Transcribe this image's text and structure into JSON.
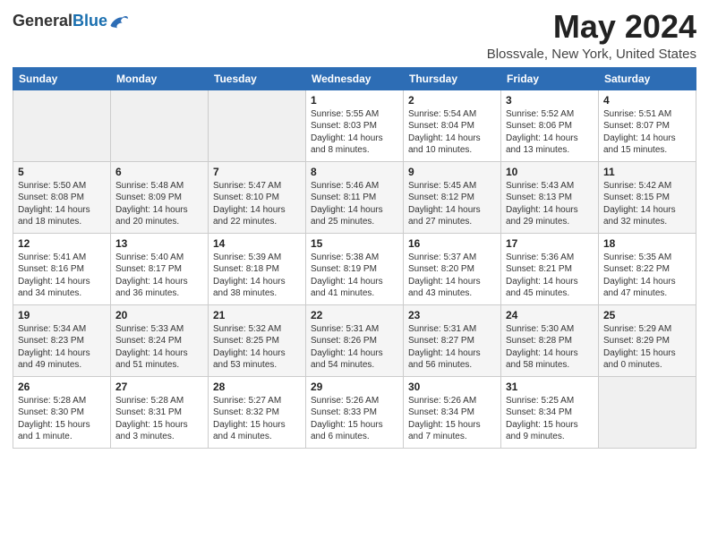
{
  "header": {
    "logo_general": "General",
    "logo_blue": "Blue",
    "title": "May 2024",
    "subtitle": "Blossvale, New York, United States"
  },
  "days_of_week": [
    "Sunday",
    "Monday",
    "Tuesday",
    "Wednesday",
    "Thursday",
    "Friday",
    "Saturday"
  ],
  "weeks": [
    [
      {
        "day": "",
        "info": ""
      },
      {
        "day": "",
        "info": ""
      },
      {
        "day": "",
        "info": ""
      },
      {
        "day": "1",
        "info": "Sunrise: 5:55 AM\nSunset: 8:03 PM\nDaylight: 14 hours\nand 8 minutes."
      },
      {
        "day": "2",
        "info": "Sunrise: 5:54 AM\nSunset: 8:04 PM\nDaylight: 14 hours\nand 10 minutes."
      },
      {
        "day": "3",
        "info": "Sunrise: 5:52 AM\nSunset: 8:06 PM\nDaylight: 14 hours\nand 13 minutes."
      },
      {
        "day": "4",
        "info": "Sunrise: 5:51 AM\nSunset: 8:07 PM\nDaylight: 14 hours\nand 15 minutes."
      }
    ],
    [
      {
        "day": "5",
        "info": "Sunrise: 5:50 AM\nSunset: 8:08 PM\nDaylight: 14 hours\nand 18 minutes."
      },
      {
        "day": "6",
        "info": "Sunrise: 5:48 AM\nSunset: 8:09 PM\nDaylight: 14 hours\nand 20 minutes."
      },
      {
        "day": "7",
        "info": "Sunrise: 5:47 AM\nSunset: 8:10 PM\nDaylight: 14 hours\nand 22 minutes."
      },
      {
        "day": "8",
        "info": "Sunrise: 5:46 AM\nSunset: 8:11 PM\nDaylight: 14 hours\nand 25 minutes."
      },
      {
        "day": "9",
        "info": "Sunrise: 5:45 AM\nSunset: 8:12 PM\nDaylight: 14 hours\nand 27 minutes."
      },
      {
        "day": "10",
        "info": "Sunrise: 5:43 AM\nSunset: 8:13 PM\nDaylight: 14 hours\nand 29 minutes."
      },
      {
        "day": "11",
        "info": "Sunrise: 5:42 AM\nSunset: 8:15 PM\nDaylight: 14 hours\nand 32 minutes."
      }
    ],
    [
      {
        "day": "12",
        "info": "Sunrise: 5:41 AM\nSunset: 8:16 PM\nDaylight: 14 hours\nand 34 minutes."
      },
      {
        "day": "13",
        "info": "Sunrise: 5:40 AM\nSunset: 8:17 PM\nDaylight: 14 hours\nand 36 minutes."
      },
      {
        "day": "14",
        "info": "Sunrise: 5:39 AM\nSunset: 8:18 PM\nDaylight: 14 hours\nand 38 minutes."
      },
      {
        "day": "15",
        "info": "Sunrise: 5:38 AM\nSunset: 8:19 PM\nDaylight: 14 hours\nand 41 minutes."
      },
      {
        "day": "16",
        "info": "Sunrise: 5:37 AM\nSunset: 8:20 PM\nDaylight: 14 hours\nand 43 minutes."
      },
      {
        "day": "17",
        "info": "Sunrise: 5:36 AM\nSunset: 8:21 PM\nDaylight: 14 hours\nand 45 minutes."
      },
      {
        "day": "18",
        "info": "Sunrise: 5:35 AM\nSunset: 8:22 PM\nDaylight: 14 hours\nand 47 minutes."
      }
    ],
    [
      {
        "day": "19",
        "info": "Sunrise: 5:34 AM\nSunset: 8:23 PM\nDaylight: 14 hours\nand 49 minutes."
      },
      {
        "day": "20",
        "info": "Sunrise: 5:33 AM\nSunset: 8:24 PM\nDaylight: 14 hours\nand 51 minutes."
      },
      {
        "day": "21",
        "info": "Sunrise: 5:32 AM\nSunset: 8:25 PM\nDaylight: 14 hours\nand 53 minutes."
      },
      {
        "day": "22",
        "info": "Sunrise: 5:31 AM\nSunset: 8:26 PM\nDaylight: 14 hours\nand 54 minutes."
      },
      {
        "day": "23",
        "info": "Sunrise: 5:31 AM\nSunset: 8:27 PM\nDaylight: 14 hours\nand 56 minutes."
      },
      {
        "day": "24",
        "info": "Sunrise: 5:30 AM\nSunset: 8:28 PM\nDaylight: 14 hours\nand 58 minutes."
      },
      {
        "day": "25",
        "info": "Sunrise: 5:29 AM\nSunset: 8:29 PM\nDaylight: 15 hours\nand 0 minutes."
      }
    ],
    [
      {
        "day": "26",
        "info": "Sunrise: 5:28 AM\nSunset: 8:30 PM\nDaylight: 15 hours\nand 1 minute."
      },
      {
        "day": "27",
        "info": "Sunrise: 5:28 AM\nSunset: 8:31 PM\nDaylight: 15 hours\nand 3 minutes."
      },
      {
        "day": "28",
        "info": "Sunrise: 5:27 AM\nSunset: 8:32 PM\nDaylight: 15 hours\nand 4 minutes."
      },
      {
        "day": "29",
        "info": "Sunrise: 5:26 AM\nSunset: 8:33 PM\nDaylight: 15 hours\nand 6 minutes."
      },
      {
        "day": "30",
        "info": "Sunrise: 5:26 AM\nSunset: 8:34 PM\nDaylight: 15 hours\nand 7 minutes."
      },
      {
        "day": "31",
        "info": "Sunrise: 5:25 AM\nSunset: 8:34 PM\nDaylight: 15 hours\nand 9 minutes."
      },
      {
        "day": "",
        "info": ""
      }
    ]
  ]
}
